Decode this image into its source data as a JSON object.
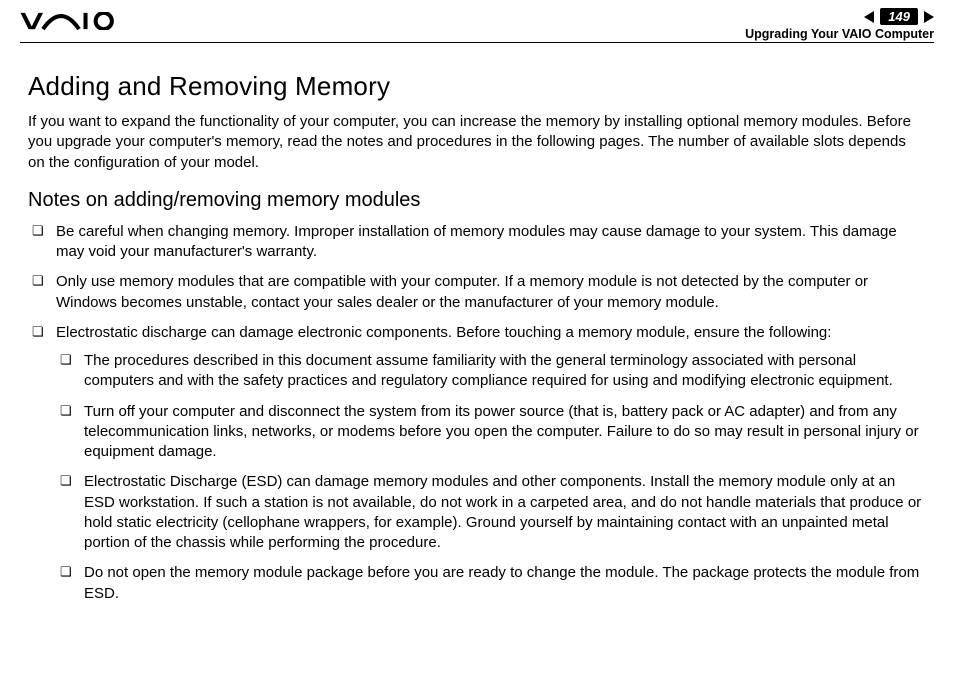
{
  "header": {
    "page_number": "149",
    "section": "Upgrading Your VAIO Computer"
  },
  "content": {
    "title": "Adding and Removing Memory",
    "intro": "If you want to expand the functionality of your computer, you can increase the memory by installing optional memory modules. Before you upgrade your computer's memory, read the notes and procedures in the following pages. The number of available slots depends on the configuration of your model.",
    "subtitle": "Notes on adding/removing memory modules",
    "bullets": [
      "Be careful when changing memory. Improper installation of memory modules may cause damage to your system. This damage may void your manufacturer's warranty.",
      "Only use memory modules that are compatible with your computer. If a memory module is not detected by the computer or Windows becomes unstable, contact your sales dealer or the manufacturer of your memory module.",
      "Electrostatic discharge can damage electronic components. Before touching a memory module, ensure the following:"
    ],
    "sub_bullets": [
      "The procedures described in this document assume familiarity with the general terminology associated with personal computers and with the safety practices and regulatory compliance required for using and modifying electronic equipment.",
      "Turn off your computer and disconnect the system from its power source (that is, battery pack or AC adapter) and from any telecommunication links, networks, or modems before you open the computer. Failure to do so may result in personal injury or equipment damage.",
      "Electrostatic Discharge (ESD) can damage memory modules and other components. Install the memory module only at an ESD workstation. If such a station is not available, do not work in a carpeted area, and do not handle materials that produce or hold static electricity (cellophane wrappers, for example). Ground yourself by maintaining contact with an unpainted metal portion of the chassis while performing the procedure.",
      "Do not open the memory module package before you are ready to change the module. The package protects the module from ESD."
    ]
  }
}
